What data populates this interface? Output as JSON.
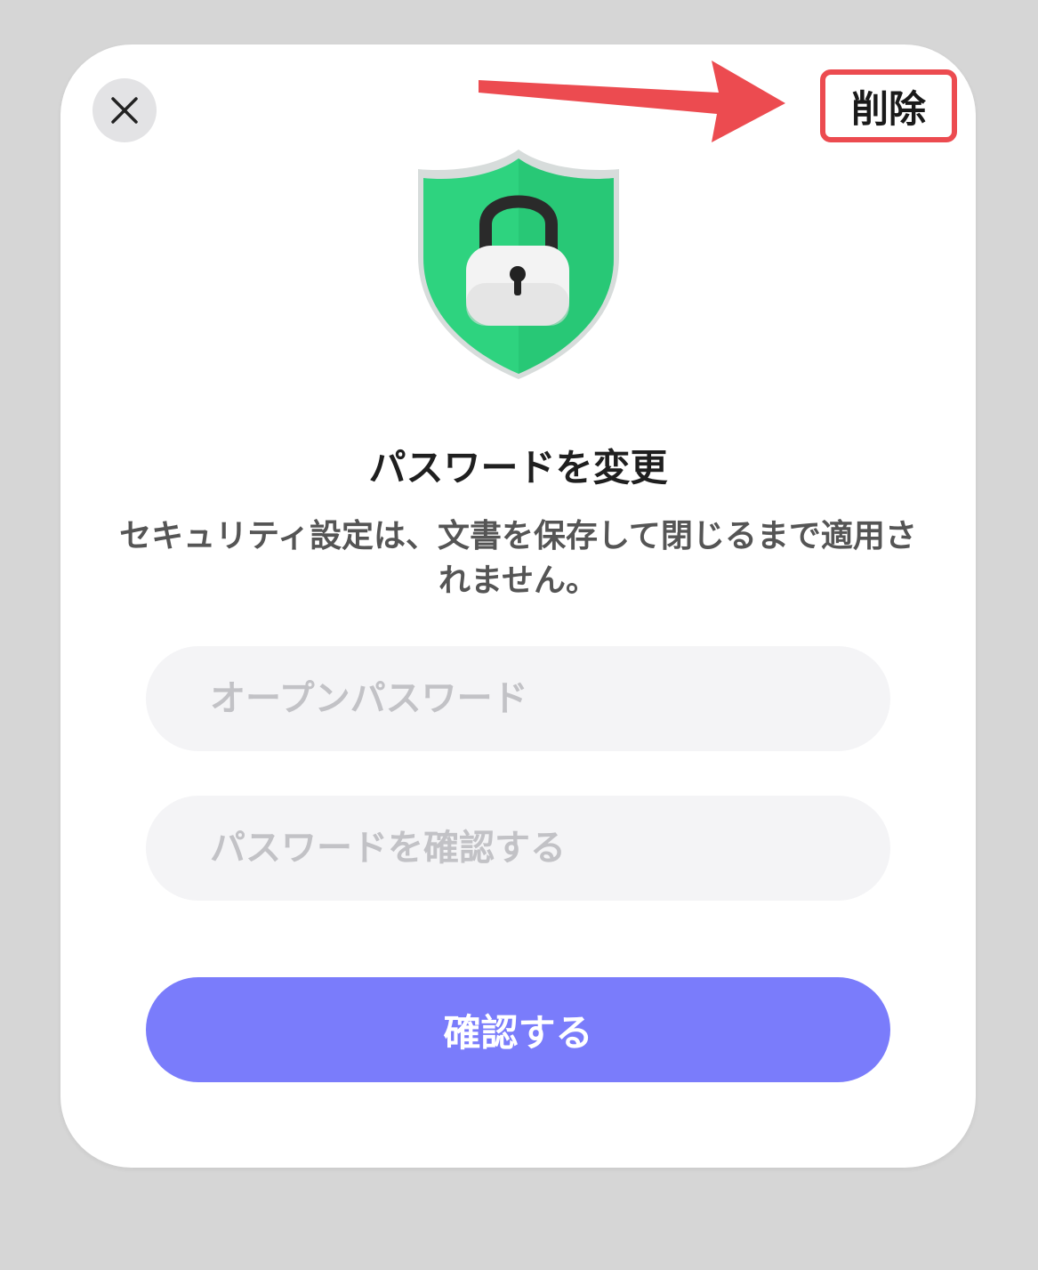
{
  "dialog": {
    "remove_label": "削除",
    "title": "パスワードを変更",
    "description": "セキュリティ設定は、文書を保存して閉じるまで適用されません。",
    "open_password_placeholder": "オープンパスワード",
    "confirm_password_placeholder": "パスワードを確認する",
    "confirm_label": "確認する"
  },
  "icons": {
    "close": "close-icon",
    "shield": "shield-lock-icon",
    "arrow": "annotation-arrow"
  },
  "colors": {
    "accent": "#7a7cfb",
    "annotation": "#ec4b50",
    "shield_green": "#2ed37f"
  }
}
